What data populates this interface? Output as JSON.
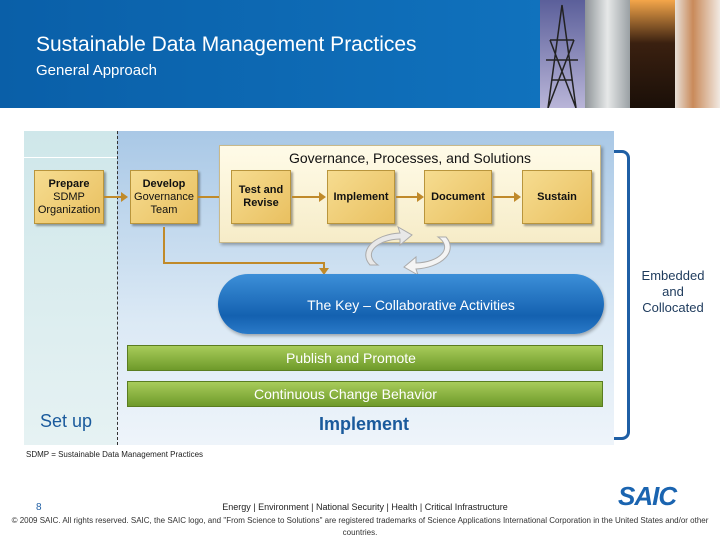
{
  "header": {
    "title": "Sustainable Data Management Practices",
    "subtitle": "General Approach",
    "photos": [
      "power-pylon",
      "storage-tank",
      "oil-rig",
      "scientist"
    ]
  },
  "diagram": {
    "governance_title": "Governance, Processes, and Solutions",
    "prepare": {
      "line1": "Prepare",
      "line2": "SDMP",
      "line3": "Organization"
    },
    "develop": {
      "line1": "Develop",
      "line2": "Governance",
      "line3": "Team"
    },
    "steps": [
      {
        "line1": "Test and",
        "line2": "Revise"
      },
      {
        "line1": "Implement"
      },
      {
        "line1": "Document"
      },
      {
        "line1": "Sustain"
      }
    ],
    "key": "The Key – Collaborative Activities",
    "bars": [
      "Publish and Promote",
      "Continuous Change Behavior"
    ],
    "setup_label": "Set up",
    "implement_label": "Implement",
    "embedded": "Embedded and Collocated"
  },
  "footer": {
    "note": "SDMP = Sustainable Data Management Practices",
    "page": "8",
    "sectors": "Energy  |  Environment  |  National Security  |  Health  |  Critical Infrastructure",
    "copyright": "© 2009 SAIC. All rights reserved. SAIC, the SAIC logo, and \"From Science to Solutions\" are registered trademarks of Science Applications International Corporation in the United States and/or other countries.",
    "logo": "SAIC"
  },
  "colors": {
    "brand": "#1278c4",
    "bar": "#8ab440",
    "box": "#efcb72"
  }
}
